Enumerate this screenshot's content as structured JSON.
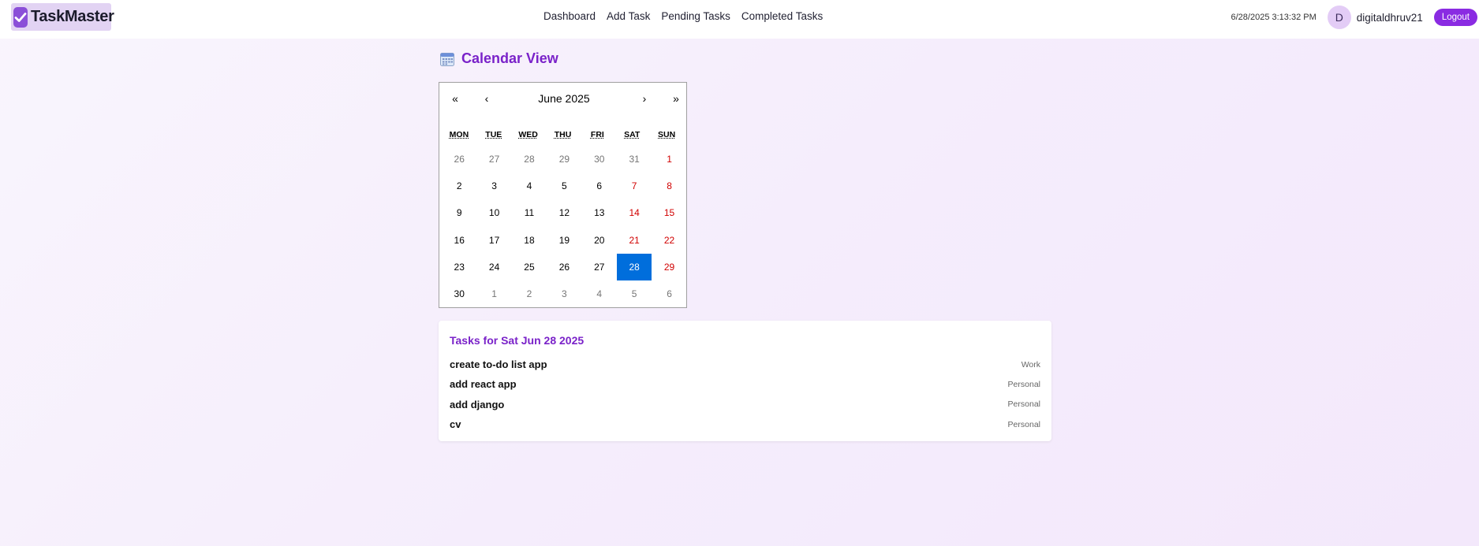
{
  "navbar": {
    "brand": "TaskMaster",
    "links": [
      "Dashboard",
      "Add Task",
      "Pending Tasks",
      "Completed Tasks"
    ],
    "clock": "6/28/2025 3:13:32 PM",
    "avatar_initial": "D",
    "username": "digitaldhruv21",
    "logout_label": "Logout"
  },
  "page": {
    "title": "Calendar View"
  },
  "calendar": {
    "month_label": "June 2025",
    "nav": {
      "prev_year": "«",
      "prev_month": "‹",
      "next_month": "›",
      "next_year": "»"
    },
    "weekdays": [
      "MON",
      "TUE",
      "WED",
      "THU",
      "FRI",
      "SAT",
      "SUN"
    ],
    "selected_day": "28",
    "weeks": [
      [
        "26",
        "27",
        "28",
        "29",
        "30",
        "31",
        "1"
      ],
      [
        "2",
        "3",
        "4",
        "5",
        "6",
        "7",
        "8"
      ],
      [
        "9",
        "10",
        "11",
        "12",
        "13",
        "14",
        "15"
      ],
      [
        "16",
        "17",
        "18",
        "19",
        "20",
        "21",
        "22"
      ],
      [
        "23",
        "24",
        "25",
        "26",
        "27",
        "28",
        "29"
      ],
      [
        "30",
        "1",
        "2",
        "3",
        "4",
        "5",
        "6"
      ]
    ],
    "colors": {
      "weekend": "#d10000",
      "other_month": "#757575",
      "selected_bg": "#006edc"
    }
  },
  "tasks": {
    "heading": "Tasks for Sat Jun 28 2025",
    "items": [
      {
        "name": "create to-do list app",
        "category": "Work"
      },
      {
        "name": "add react app",
        "category": "Personal"
      },
      {
        "name": "add django",
        "category": "Personal"
      },
      {
        "name": "cv",
        "category": "Personal"
      }
    ]
  },
  "colors": {
    "accent": "#8a2be2",
    "heading": "#7a22c9"
  }
}
